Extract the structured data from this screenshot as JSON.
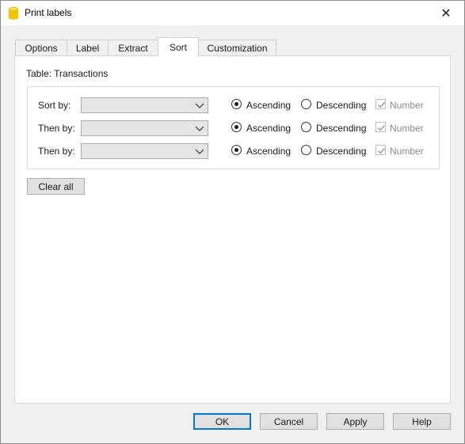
{
  "window": {
    "title": "Print labels",
    "icon": "banana-app-icon",
    "close_glyph": "✕"
  },
  "tabs": [
    {
      "label": "Options",
      "active": false
    },
    {
      "label": "Label",
      "active": false
    },
    {
      "label": "Extract",
      "active": false
    },
    {
      "label": "Sort",
      "active": true
    },
    {
      "label": "Customization",
      "active": false
    }
  ],
  "sort_tab": {
    "table_label": "Table: Transactions",
    "rows": [
      {
        "label": "Sort by:",
        "field_value": "",
        "ascending_label": "Ascending",
        "descending_label": "Descending",
        "order": "ascending",
        "number_label": "Number",
        "number_checked": true,
        "number_enabled": false
      },
      {
        "label": "Then by:",
        "field_value": "",
        "ascending_label": "Ascending",
        "descending_label": "Descending",
        "order": "ascending",
        "number_label": "Number",
        "number_checked": true,
        "number_enabled": false
      },
      {
        "label": "Then by:",
        "field_value": "",
        "ascending_label": "Ascending",
        "descending_label": "Descending",
        "order": "ascending",
        "number_label": "Number",
        "number_checked": true,
        "number_enabled": false
      }
    ],
    "clear_all_label": "Clear all"
  },
  "footer": {
    "ok_label": "OK",
    "cancel_label": "Cancel",
    "apply_label": "Apply",
    "help_label": "Help"
  },
  "colors": {
    "dialog_bg": "#f0f0f0",
    "panel_bg": "#ffffff",
    "default_button_border": "#0078d7",
    "app_icon": "#f5c400",
    "disabled_text": "#8c8c8c"
  }
}
